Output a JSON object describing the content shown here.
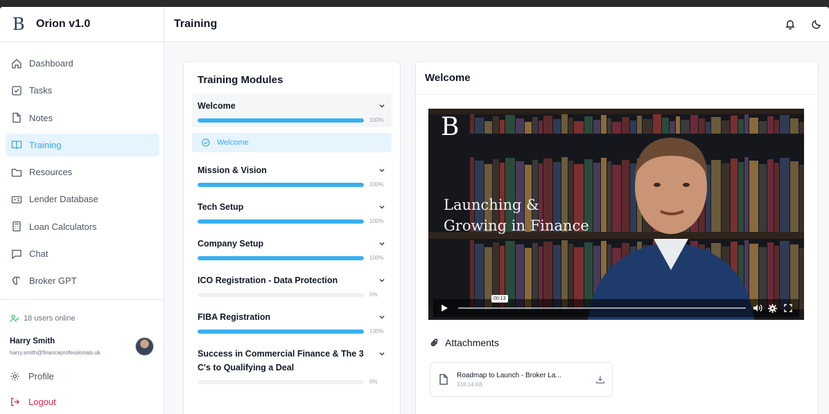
{
  "app": {
    "name": "Orion v1.0",
    "logo": "B"
  },
  "colors": {
    "accent": "#38b0ef",
    "active_bg": "#e6f4fd",
    "logout": "#e11d48"
  },
  "sidebar": {
    "items": [
      {
        "label": "Dashboard",
        "icon": "home-icon",
        "active": false
      },
      {
        "label": "Tasks",
        "icon": "checkbox-icon",
        "active": false
      },
      {
        "label": "Notes",
        "icon": "file-icon",
        "active": false
      },
      {
        "label": "Training",
        "icon": "book-icon",
        "active": true
      },
      {
        "label": "Resources",
        "icon": "folder-icon",
        "active": false
      },
      {
        "label": "Lender Database",
        "icon": "id-card-icon",
        "active": false
      },
      {
        "label": "Loan Calculators",
        "icon": "calculator-icon",
        "active": false
      },
      {
        "label": "Chat",
        "icon": "chat-icon",
        "active": false
      },
      {
        "label": "Broker GPT",
        "icon": "brain-icon",
        "active": false
      }
    ],
    "online": "18 users online",
    "user": {
      "name": "Harry Smith",
      "email": "harry.smith@financeprofessionals.uk"
    },
    "profile_label": "Profile",
    "logout_label": "Logout"
  },
  "header": {
    "title": "Training"
  },
  "modules_panel": {
    "title": "Training Modules",
    "modules": [
      {
        "label": "Welcome",
        "percent": 100,
        "percent_label": "100%",
        "open": true,
        "lessons": [
          {
            "label": "Welcome",
            "done": true
          }
        ]
      },
      {
        "label": "Mission & Vision",
        "percent": 100,
        "percent_label": "100%"
      },
      {
        "label": "Tech Setup",
        "percent": 100,
        "percent_label": "100%"
      },
      {
        "label": "Company Setup",
        "percent": 100,
        "percent_label": "100%"
      },
      {
        "label": "ICO Registration - Data Protection",
        "percent": 0,
        "percent_label": "0%"
      },
      {
        "label": "FIBA Registration",
        "percent": 100,
        "percent_label": "100%"
      },
      {
        "label": "Success in Commercial Finance & The 3 C's to Qualifying a Deal",
        "percent": 0,
        "percent_label": "0%"
      }
    ]
  },
  "lesson_panel": {
    "title": "Welcome",
    "video": {
      "logo": "B",
      "headline_line1": "Launching &",
      "headline_line2": "Growing in Finance",
      "time": "00:13"
    },
    "attachments_title": "Attachments",
    "attachments": [
      {
        "name": "Roadmap to Launch - Broker La...",
        "size": "318.14 KB"
      }
    ]
  }
}
